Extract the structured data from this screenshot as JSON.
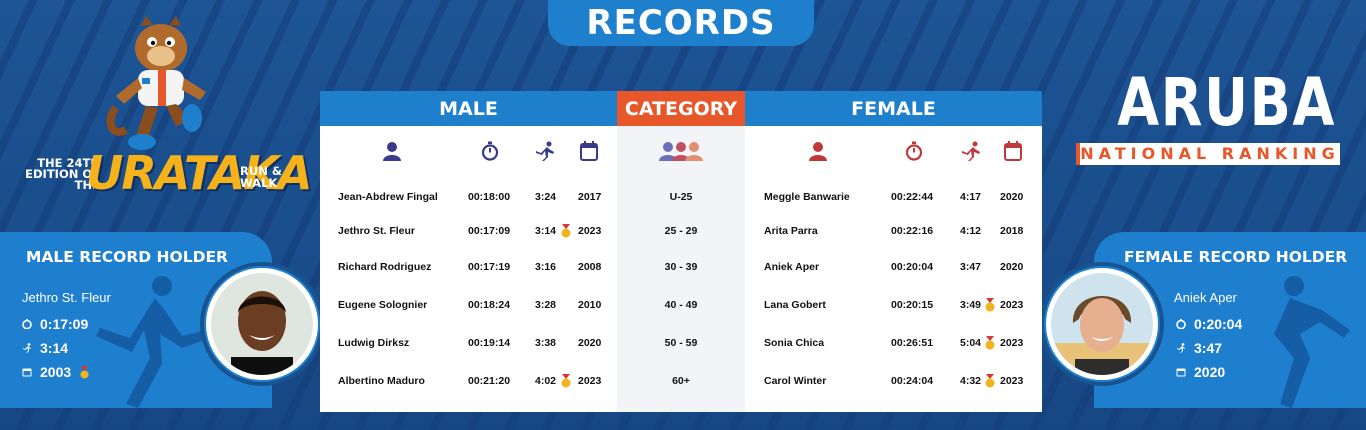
{
  "title": "RECORDS",
  "logo": {
    "edition": "THE 24TH EDITION OF THE",
    "word": "URATAKA",
    "run": "RUN & WALK"
  },
  "ranking": {
    "country": "ARUBA",
    "subtitle": "NATIONAL RANKING"
  },
  "headers": {
    "male": "MALE",
    "category": "CATEGORY",
    "female": "FEMALE"
  },
  "male_holder": {
    "title": "MALE RECORD HOLDER",
    "name": "Jethro St. Fleur",
    "time": "0:17:09",
    "pace": "3:14",
    "year": "2003"
  },
  "female_holder": {
    "title": "FEMALE RECORD HOLDER",
    "name": "Aniek Aper",
    "time": "0:20:04",
    "pace": "3:47",
    "year": "2020"
  },
  "categories": [
    "U-25",
    "25 - 29",
    "30 - 39",
    "40 - 49",
    "50 - 59",
    "60+"
  ],
  "male_rows": [
    {
      "name": "Jean-Abdrew Fingal",
      "time": "00:18:00",
      "pace": "3:24",
      "year": "2017",
      "medal": false
    },
    {
      "name": "Jethro St. Fleur",
      "time": "00:17:09",
      "pace": "3:14",
      "year": "2023",
      "medal": true
    },
    {
      "name": "Richard Rodriguez",
      "time": "00:17:19",
      "pace": "3:16",
      "year": "2008",
      "medal": false
    },
    {
      "name": "Eugene Solognier",
      "time": "00:18:24",
      "pace": "3:28",
      "year": "2010",
      "medal": false
    },
    {
      "name": "Ludwig Dirksz",
      "time": "00:19:14",
      "pace": "3:38",
      "year": "2020",
      "medal": false
    },
    {
      "name": "Albertino Maduro",
      "time": "00:21:20",
      "pace": "4:02",
      "year": "2023",
      "medal": true
    }
  ],
  "female_rows": [
    {
      "name": "Meggle Banwarie",
      "time": "00:22:44",
      "pace": "4:17",
      "year": "2020",
      "medal": false
    },
    {
      "name": "Arita Parra",
      "time": "00:22:16",
      "pace": "4:12",
      "year": "2018",
      "medal": false
    },
    {
      "name": "Aniek Aper",
      "time": "00:20:04",
      "pace": "3:47",
      "year": "2020",
      "medal": false
    },
    {
      "name": "Lana Gobert",
      "time": "00:20:15",
      "pace": "3:49",
      "year": "2023",
      "medal": true
    },
    {
      "name": "Sonia Chica",
      "time": "00:26:51",
      "pace": "5:04",
      "year": "2023",
      "medal": true
    },
    {
      "name": "Carol Winter",
      "time": "00:24:04",
      "pace": "4:32",
      "year": "2023",
      "medal": true
    }
  ],
  "colors": {
    "blue": "#1e7fcc",
    "orange": "#e8572a",
    "male_icon": "#3a3a8c",
    "female_icon": "#c0393a"
  }
}
